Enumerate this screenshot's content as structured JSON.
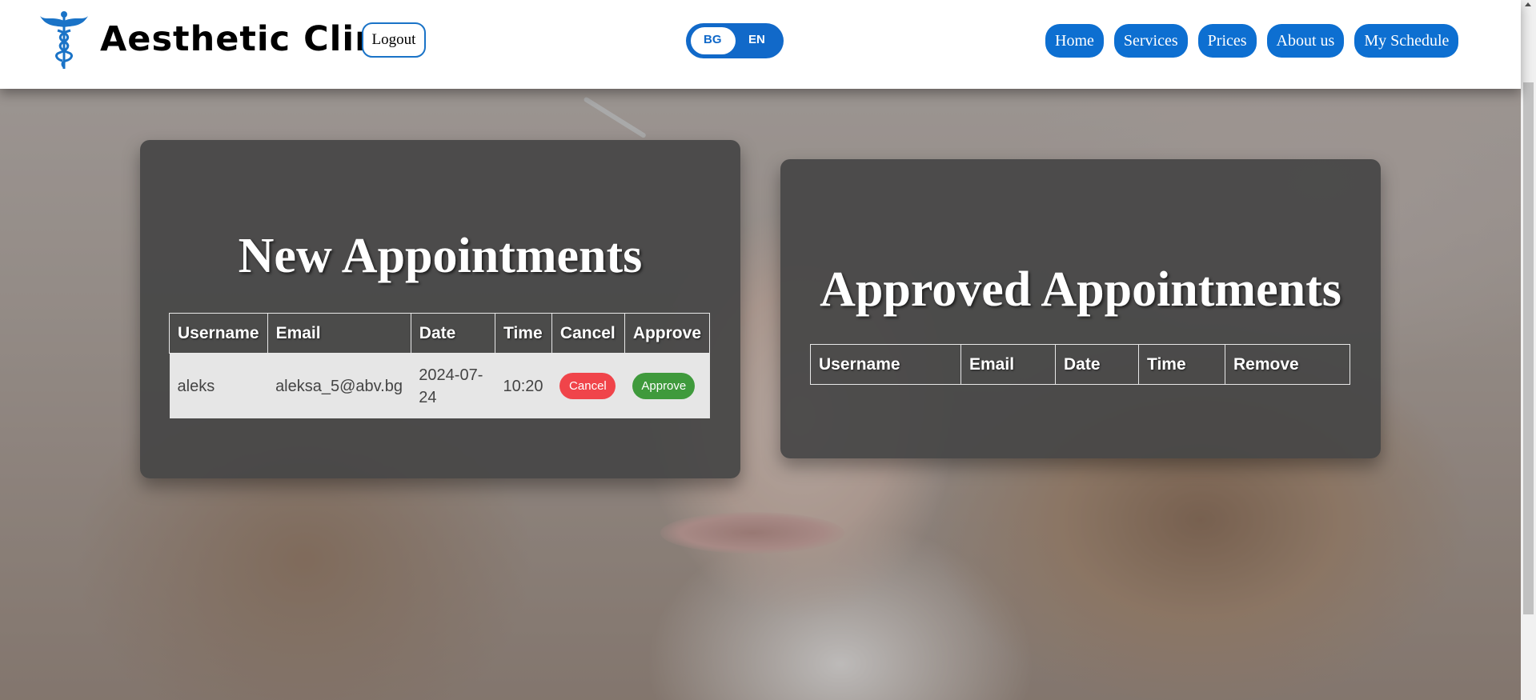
{
  "header": {
    "brand": "Aesthetic Clinic",
    "logout_label": "Logout",
    "language": {
      "options": [
        "BG",
        "EN"
      ],
      "selected": "BG"
    },
    "nav": [
      "Home",
      "Services",
      "Prices",
      "About us",
      "My Schedule"
    ],
    "accent_color": "#0d6fd1"
  },
  "new_appointments": {
    "title": "New Appointments",
    "columns": [
      "Username",
      "Email",
      "Date",
      "Time",
      "Cancel",
      "Approve"
    ],
    "rows": [
      {
        "username": "aleks",
        "email": "aleksa_5@abv.bg",
        "date": "2024-07-24",
        "time": "10:20",
        "cancel_label": "Cancel",
        "approve_label": "Approve"
      }
    ]
  },
  "approved_appointments": {
    "title": "Approved Appointments",
    "columns": [
      "Username",
      "Email",
      "Date",
      "Time",
      "Remove"
    ],
    "rows": []
  },
  "colors": {
    "cancel": "#f0444a",
    "approve": "#3f9a3c",
    "card_bg": "#464646"
  }
}
